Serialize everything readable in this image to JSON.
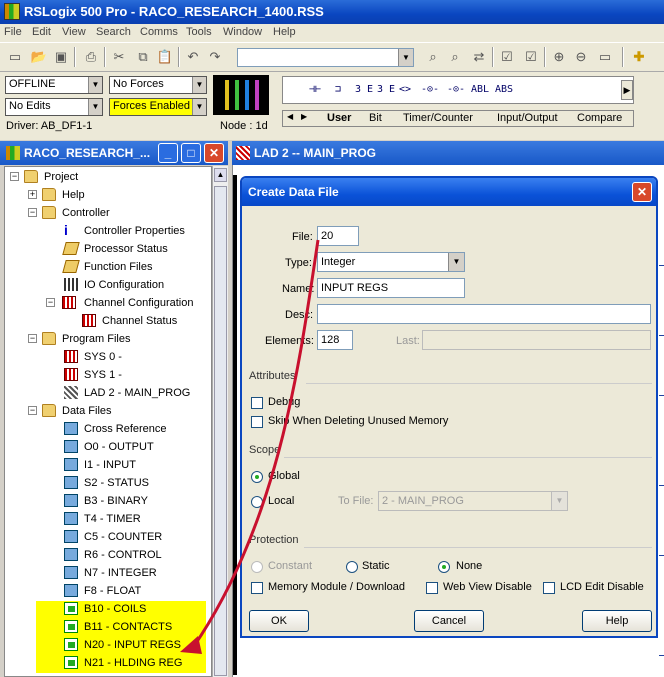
{
  "app": {
    "title": "RSLogix 500 Pro - RACO_RESEARCH_1400.RSS"
  },
  "menu": [
    "File",
    "Edit",
    "View",
    "Search",
    "Comms",
    "Tools",
    "Window",
    "Help"
  ],
  "status": {
    "mode": "OFFLINE",
    "forces": "No Forces",
    "edits": "No Edits",
    "forces_enabled": "Forces Enabled",
    "driver": "Driver: AB_DF1-1",
    "node": "Node : 1d"
  },
  "instructions": [
    "⊣⊢",
    "⊐",
    "3 E",
    "3 E",
    "<>",
    "-⊙-",
    "-⊙-",
    "ABL",
    "ABS"
  ],
  "inst_tabs": [
    "User",
    "Bit",
    "Timer/Counter",
    "Input/Output",
    "Compare"
  ],
  "project_window": {
    "title": "RACO_RESEARCH_...",
    "min": "_",
    "max": "□",
    "close": "✕"
  },
  "ladder_window": {
    "title": "LAD 2 -- MAIN_PROG"
  },
  "tree": {
    "project": "Project",
    "help": "Help",
    "controller": "Controller",
    "controller_items": [
      "Controller Properties",
      "Processor Status",
      "Function Files",
      "IO Configuration",
      "Channel Configuration"
    ],
    "channel_status": "Channel Status",
    "program_files": "Program Files",
    "program_items": [
      "SYS 0 -",
      "SYS 1 -",
      "LAD 2 - MAIN_PROG"
    ],
    "data_files": "Data Files",
    "data_items": [
      "Cross Reference",
      "O0 - OUTPUT",
      "I1 - INPUT",
      "S2 - STATUS",
      "B3 - BINARY",
      "T4 - TIMER",
      "C5 - COUNTER",
      "R6 - CONTROL",
      "N7 - INTEGER",
      "F8 - FLOAT",
      "B10 - COILS",
      "B11 - CONTACTS",
      "N20 - INPUT REGS",
      "N21 - HLDING REG"
    ]
  },
  "dialog": {
    "title": "Create Data File",
    "file_label": "File:",
    "file_value": "20",
    "type_label": "Type:",
    "type_value": "Integer",
    "name_label": "Name:",
    "name_value": "INPUT REGS",
    "desc_label": "Desc:",
    "desc_value": "",
    "elements_label": "Elements:",
    "elements_value": "128",
    "last_label": "Last:",
    "last_value": "",
    "attributes_label": "Attributes",
    "debug_label": "Debug",
    "skip_label": "Skip When Deleting Unused Memory",
    "scope_label": "Scope",
    "global_label": "Global",
    "local_label": "Local",
    "tofile_label": "To File:",
    "tofile_value": "2 - MAIN_PROG",
    "protection_label": "Protection",
    "constant_label": "Constant",
    "static_label": "Static",
    "none_label": "None",
    "memmod_label": "Memory Module / Download",
    "webview_label": "Web View Disable",
    "lcd_label": "LCD Edit Disable",
    "ok": "OK",
    "cancel": "Cancel",
    "help": "Help"
  },
  "colors": {
    "highlight": "#ffff00",
    "arrow": "#c8102e",
    "titlebar": "#0a46c0"
  }
}
